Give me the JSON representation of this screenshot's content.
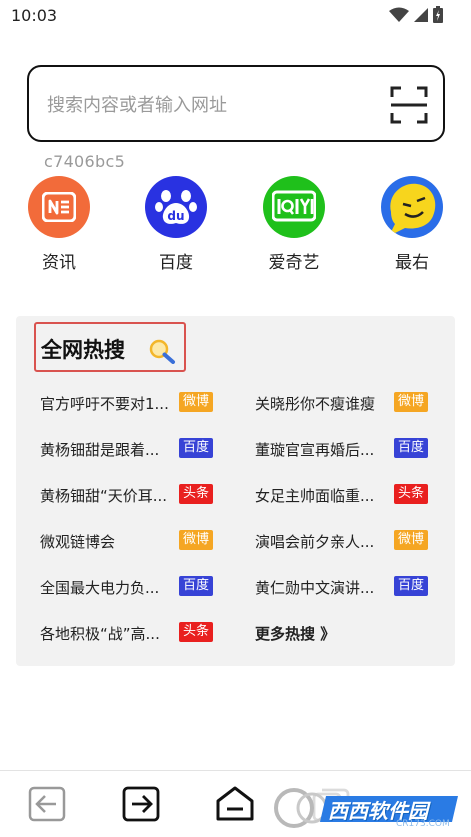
{
  "status": {
    "time": "10:03"
  },
  "search": {
    "placeholder": "搜索内容或者输入网址"
  },
  "device_id": "c7406bc5",
  "shortcuts": [
    {
      "label": "资讯",
      "icon": "news-icon",
      "color": "#f26b3a"
    },
    {
      "label": "百度",
      "icon": "baidu-paw-icon",
      "color": "#2932e1"
    },
    {
      "label": "爱奇艺",
      "icon": "iqiyi-icon",
      "color": "#1fc01b"
    },
    {
      "label": "最右",
      "icon": "zuiyou-icon",
      "color": "#2a6de8"
    }
  ],
  "hot": {
    "title": "全网热搜",
    "items": [
      {
        "text": "官方呼吁不要对1...",
        "source": "微博"
      },
      {
        "text": "关晓彤你不瘦谁瘦",
        "source": "微博"
      },
      {
        "text": "黄杨钿甜是跟着...",
        "source": "百度"
      },
      {
        "text": "董璇官宣再婚后...",
        "source": "百度"
      },
      {
        "text": "黄杨钿甜“天价耳...",
        "source": "头条"
      },
      {
        "text": "女足主帅面临重...",
        "source": "头条"
      },
      {
        "text": "微观链博会",
        "source": "微博"
      },
      {
        "text": "演唱会前夕亲人...",
        "source": "微博"
      },
      {
        "text": "全国最大电力负...",
        "source": "百度"
      },
      {
        "text": "黄仁勋中文演讲...",
        "source": "百度"
      },
      {
        "text": "各地积极“战”高...",
        "source": "头条"
      }
    ],
    "more": "更多热搜 》",
    "source_colors": {
      "微博": "#f5a623",
      "百度": "#3743d6",
      "头条": "#e9201f"
    }
  },
  "watermark": {
    "text": "西西软件园",
    "sub": "CR173.COM"
  }
}
